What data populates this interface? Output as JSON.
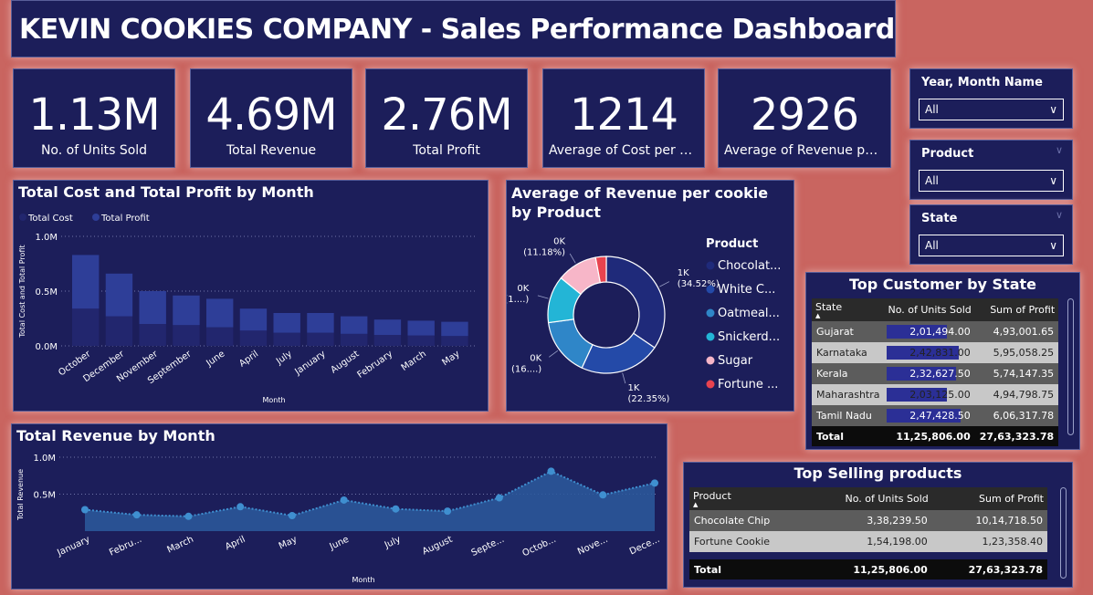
{
  "title": "KEVIN COOKIES COMPANY - Sales Performance Dashboard",
  "kpis": [
    {
      "value": "1.13M",
      "label": "No. of Units Sold"
    },
    {
      "value": "4.69M",
      "label": "Total Revenue"
    },
    {
      "value": "2.76M",
      "label": "Total Profit"
    },
    {
      "value": "1214",
      "label": "Average of Cost per co..."
    },
    {
      "value": "2926",
      "label": "Average of Revenue per c..."
    }
  ],
  "slicers": [
    {
      "title": "Year, Month Name",
      "value": "All"
    },
    {
      "title": "Product",
      "value": "All"
    },
    {
      "title": "State",
      "value": "All"
    }
  ],
  "colors": {
    "panel": "#1c1e5a",
    "background": "#c96560",
    "cost": "#22266e",
    "profit": "#2e3e98",
    "line": "#3f8fd0",
    "area": "#2c5a9e"
  },
  "chart_data": [
    {
      "id": "cost_profit",
      "type": "bar",
      "title": "Total Cost and Total Profit by Month",
      "xlabel": "Month",
      "ylabel": "Total Cost and Total Profit",
      "ylim": [
        0,
        1000000
      ],
      "yticks": [
        {
          "v": 0,
          "label": "0.0M"
        },
        {
          "v": 500000,
          "label": "0.5M"
        },
        {
          "v": 1000000,
          "label": "1.0M"
        }
      ],
      "stacked": true,
      "legend": "top-left",
      "grid": true,
      "categories": [
        "October",
        "December",
        "November",
        "September",
        "June",
        "April",
        "July",
        "January",
        "August",
        "February",
        "March",
        "May"
      ],
      "series": [
        {
          "name": "Total Cost",
          "color": "#22266e",
          "values": [
            340000,
            270000,
            200000,
            190000,
            170000,
            140000,
            120000,
            120000,
            110000,
            100000,
            95000,
            90000
          ]
        },
        {
          "name": "Total Profit",
          "color": "#2e3e98",
          "values": [
            490000,
            390000,
            300000,
            270000,
            260000,
            200000,
            180000,
            180000,
            160000,
            140000,
            135000,
            130000
          ]
        }
      ]
    },
    {
      "id": "revenue_per_cookie",
      "type": "pie",
      "title": "Average of Revenue per cookie by Product",
      "legend_title": "Product",
      "legend": "right",
      "categories": [
        "Chocolat...",
        "White C...",
        "Oatmeal...",
        "Snickerd...",
        "Sugar",
        "Fortune ..."
      ],
      "values": [
        34.52,
        22.35,
        16.0,
        13.0,
        11.18,
        2.95
      ],
      "colors": [
        "#1f2a7a",
        "#244aa8",
        "#2f86c8",
        "#23b5d6",
        "#f7b6c8",
        "#e8434f"
      ],
      "data_labels": [
        {
          "value": "1K",
          "pct": "(34.52%)"
        },
        {
          "value": "1K",
          "pct": "(22.35%)"
        },
        {
          "value": "0K",
          "pct": "(16....)"
        },
        {
          "value": "0K",
          "pct": "(1....)"
        },
        {
          "value": "0K",
          "pct": "(11.18%)"
        }
      ]
    },
    {
      "id": "revenue_month",
      "type": "area",
      "title": "Total Revenue by Month",
      "xlabel": "Month",
      "ylabel": "Total Revenue",
      "ylim": [
        0,
        1000000
      ],
      "yticks": [
        {
          "v": 500000,
          "label": "0.5M"
        },
        {
          "v": 1000000,
          "label": "1.0M"
        }
      ],
      "grid": true,
      "categories": [
        "January",
        "Febru...",
        "March",
        "April",
        "May",
        "June",
        "July",
        "August",
        "Septe...",
        "Octob...",
        "Nove...",
        "Dece..."
      ],
      "values": [
        290000,
        220000,
        200000,
        330000,
        210000,
        420000,
        300000,
        270000,
        450000,
        810000,
        490000,
        650000
      ]
    }
  ],
  "state_table": {
    "title": "Top Customer by State",
    "columns": [
      "State",
      "No. of Units Sold",
      "Sum of Profit"
    ],
    "rows": [
      {
        "state": "Gujarat",
        "units": "2,01,494.00",
        "profit": "4,93,001.65",
        "bar": 201494
      },
      {
        "state": "Karnataka",
        "units": "2,42,831.00",
        "profit": "5,95,058.25",
        "bar": 242831
      },
      {
        "state": "Kerala",
        "units": "2,32,627.50",
        "profit": "5,74,147.35",
        "bar": 232627.5
      },
      {
        "state": "Maharashtra",
        "units": "2,03,125.00",
        "profit": "4,94,798.75",
        "bar": 203125
      },
      {
        "state": "Tamil Nadu",
        "units": "2,47,428.50",
        "profit": "6,06,317.78",
        "bar": 247428.5
      }
    ],
    "total": {
      "label": "Total",
      "units": "11,25,806.00",
      "profit": "27,63,323.78"
    }
  },
  "product_table": {
    "title": "Top Selling products",
    "columns": [
      "Product",
      "No. of Units Sold",
      "Sum of Profit"
    ],
    "rows": [
      {
        "product": "Chocolate Chip",
        "units": "3,38,239.50",
        "profit": "10,14,718.50"
      },
      {
        "product": "Fortune Cookie",
        "units": "1,54,198.00",
        "profit": "1,23,358.40"
      }
    ],
    "total": {
      "label": "Total",
      "units": "11,25,806.00",
      "profit": "27,63,323.78"
    }
  }
}
